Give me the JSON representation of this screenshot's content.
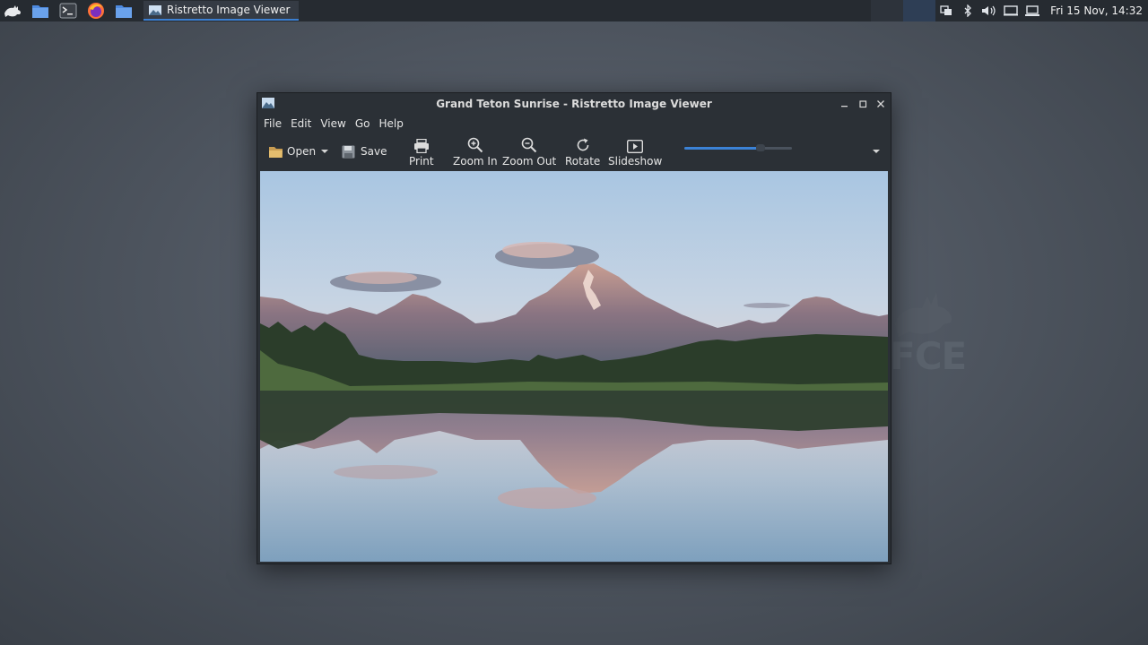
{
  "panel": {
    "launchers": [
      "xfce-menu-icon",
      "file-manager-icon",
      "terminal-icon",
      "firefox-icon",
      "folder-icon"
    ],
    "task_label": "Ristretto Image Viewer",
    "clock": "Fri 15 Nov, 14:32"
  },
  "window": {
    "title": "Grand Teton Sunrise - Ristretto Image Viewer",
    "menu": [
      "File",
      "Edit",
      "View",
      "Go",
      "Help"
    ],
    "toolbar": {
      "open": "Open",
      "save": "Save",
      "print": "Print",
      "zoom_in": "Zoom In",
      "zoom_out": "Zoom Out",
      "rotate": "Rotate",
      "slideshow": "Slideshow"
    },
    "slider_fraction": 0.7
  },
  "colors": {
    "accent": "#3b82d6",
    "panel_bg": "#262b31",
    "window_bg": "#2b3036"
  }
}
